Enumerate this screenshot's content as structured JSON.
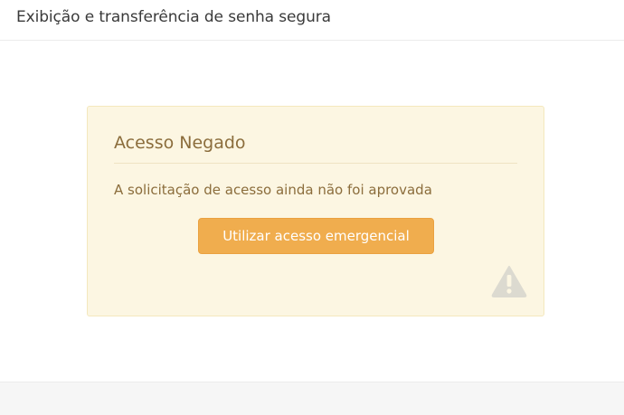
{
  "header": {
    "title": "Exibição e transferência de senha segura"
  },
  "alert": {
    "title": "Acesso Negado",
    "message": "A solicitação de acesso ainda não foi aprovada",
    "button_label": "Utilizar acesso emergencial",
    "icon": "warning-triangle-icon"
  },
  "colors": {
    "alert_background": "#fcf6e2",
    "alert_text": "#8b6d3c",
    "button_background": "#f0ad4e",
    "icon_color": "#dcdad0"
  }
}
